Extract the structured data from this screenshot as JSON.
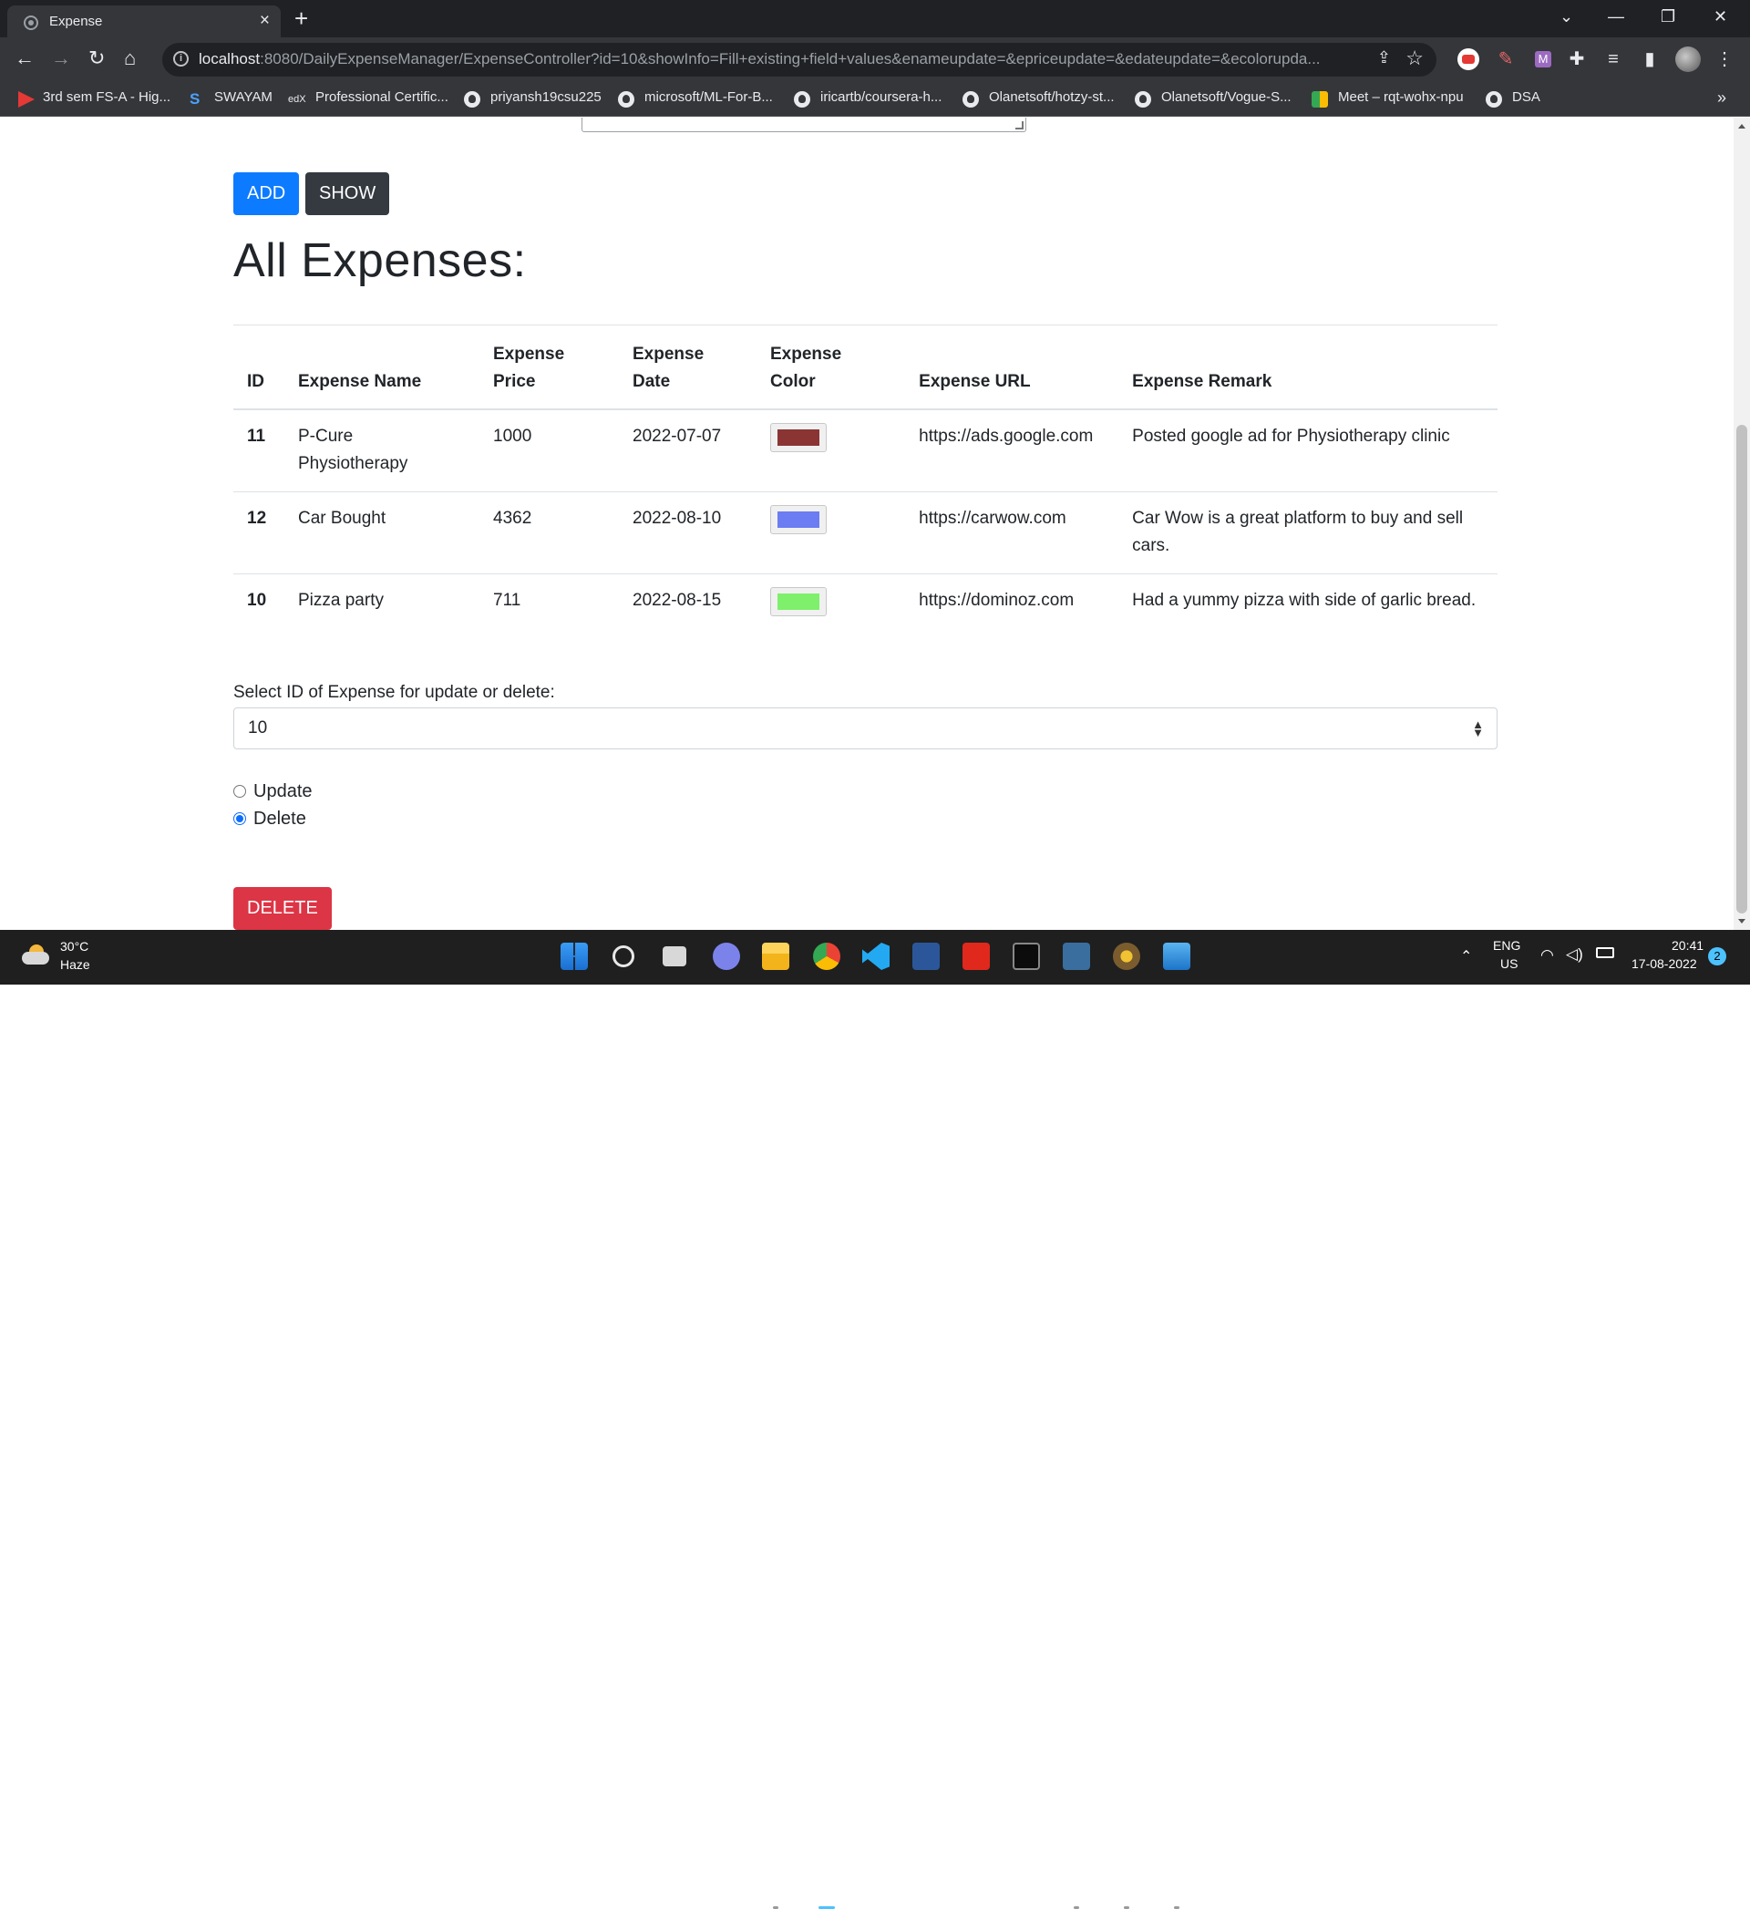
{
  "browser": {
    "tab_title": "Expense",
    "tab_close": "×",
    "new_tab": "+",
    "url_host": "localhost",
    "url_rest": ":8080/DailyExpenseManager/ExpenseController?id=10&showInfo=Fill+existing+field+values&enameupdate=&epriceupdate=&edateupdate=&ecolorupda...",
    "window_controls": {
      "tab_search": "⌄",
      "minimize": "—",
      "restore": "❐",
      "close": "✕"
    },
    "nav": {
      "back": "←",
      "forward": "→",
      "reload": "↻",
      "home": "⌂"
    },
    "bookmarks": [
      "3rd sem FS-A - Hig...",
      "SWAYAM",
      "Professional Certific...",
      "priyansh19csu225",
      "microsoft/ML-For-B...",
      "iricartb/coursera-h...",
      "Olanetsoft/hotzy-st...",
      "Olanetsoft/Vogue-S...",
      "Meet – rqt-wohx-npu",
      "DSA"
    ],
    "bookmarks_more": "»"
  },
  "page": {
    "add_label": "ADD",
    "show_label": "SHOW",
    "heading": "All Expenses:",
    "table": {
      "headers": [
        "ID",
        "Expense Name",
        "Expense Price",
        "Expense Date",
        "Expense Color",
        "Expense URL",
        "Expense Remark"
      ],
      "rows": [
        {
          "id": "11",
          "name": "P-Cure Physiotherapy",
          "price": "1000",
          "date": "2022-07-07",
          "color": "#8b3434",
          "url": "https://ads.google.com",
          "remark": "Posted google ad for Physiotherapy clinic"
        },
        {
          "id": "12",
          "name": "Car Bought",
          "price": "4362",
          "date": "2022-08-10",
          "color": "#6c7cf2",
          "url": "https://carwow.com",
          "remark": "Car Wow is a great platform to buy and sell cars."
        },
        {
          "id": "10",
          "name": "Pizza party",
          "price": "711",
          "date": "2022-08-15",
          "color": "#7ef06c",
          "url": "https://dominoz.com",
          "remark": "Had a yummy pizza with side of garlic bread."
        }
      ]
    },
    "select_label": "Select ID of Expense for update or delete:",
    "select_value": "10",
    "radio_update": "Update",
    "radio_delete": "Delete",
    "delete_label": "DELETE"
  },
  "taskbar": {
    "temperature": "30°C",
    "weather": "Haze",
    "lang": "ENG",
    "region": "US",
    "time": "20:41",
    "date": "17-08-2022",
    "notifications": "2"
  },
  "colors": {
    "primary": "#0d7bff",
    "dark": "#343a40",
    "danger": "#dc3545"
  }
}
